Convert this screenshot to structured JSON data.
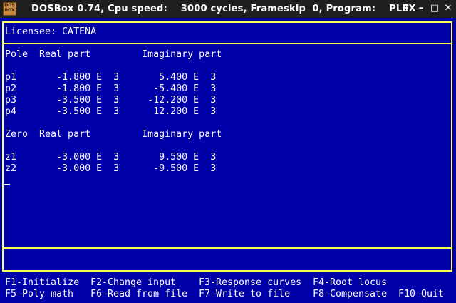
{
  "window": {
    "title": "DOSBox 0.74, Cpu speed:    3000 cycles, Frameskip  0, Program:    PLEX",
    "logo_text": "DOS BOX",
    "controls": [
      "↑",
      "–",
      "□",
      "✕"
    ]
  },
  "header": {
    "licensee": "Licensee: CATENA"
  },
  "poles": {
    "heading": "Pole  Real part         Imaginary part",
    "rows": [
      "p1       -1.800 E  3       5.400 E  3",
      "p2       -1.800 E  3      -5.400 E  3",
      "p3       -3.500 E  3     -12.200 E  3",
      "p4       -3.500 E  3      12.200 E  3"
    ]
  },
  "zeros": {
    "heading": "Zero  Real part         Imaginary part",
    "rows": [
      "z1       -3.000 E  3       9.500 E  3",
      "z2       -3.000 E  3      -9.500 E  3"
    ]
  },
  "function_keys": [
    {
      "label": "F1-Initialize"
    },
    {
      "label": "F2-Change input"
    },
    {
      "label": "F3-Response curves"
    },
    {
      "label": "F4-Root locus"
    },
    {
      "label": "F5-Poly math"
    },
    {
      "label": "F6-Read from file"
    },
    {
      "label": "F7-Write to file"
    },
    {
      "label": "F8-Compensate"
    },
    {
      "label": "F10-Quit"
    }
  ]
}
